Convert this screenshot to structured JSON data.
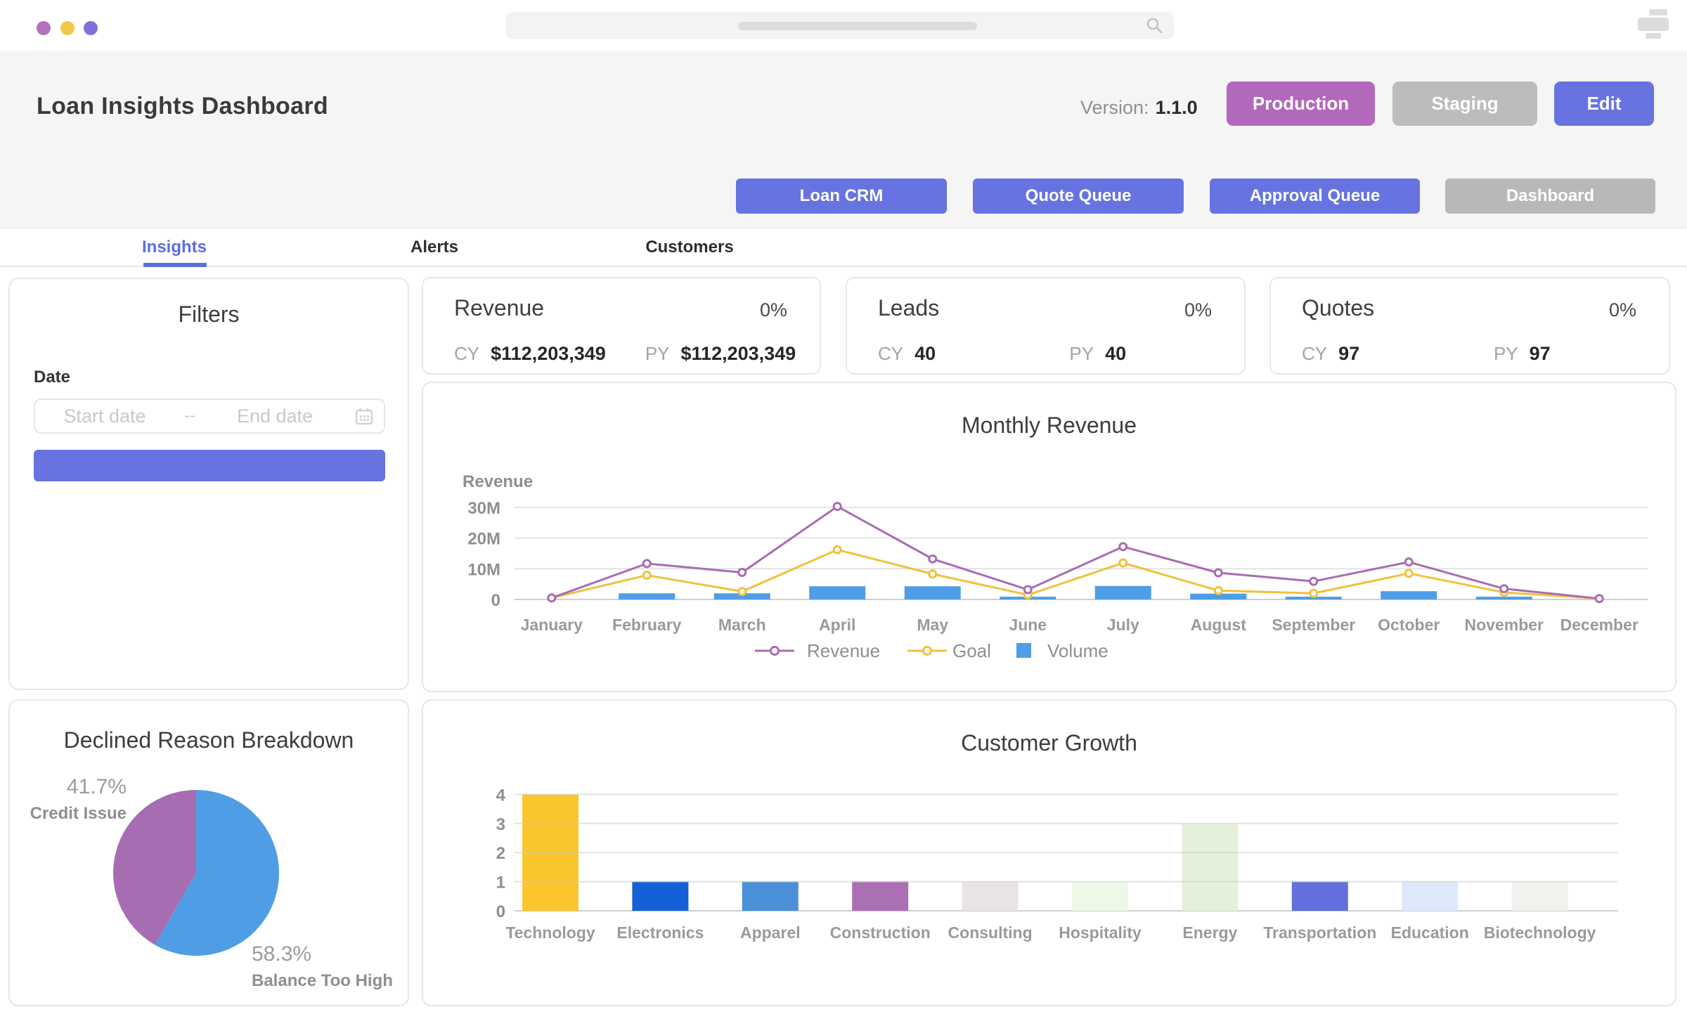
{
  "colors": {
    "accent_indigo": "#6673e0",
    "tab_active": "#5b6ee1",
    "band_background": "#f5f5f5"
  },
  "topbar": {
    "dot_colors": [
      "#b271bb",
      "#f0c94a",
      "#7e72d8"
    ],
    "icons": [
      "search-icon",
      "stacked-bars-menu-icon"
    ]
  },
  "header": {
    "title": "Loan Insights Dashboard",
    "version_label": "Version:",
    "version_value": "1.1.0",
    "env_buttons": [
      {
        "label": "Production",
        "color": "#b269bc"
      },
      {
        "label": "Staging",
        "color": "#bcbcbc"
      },
      {
        "label": "Edit",
        "color": "#6673e0"
      }
    ],
    "nav_buttons": [
      {
        "label": "Loan CRM",
        "color": "#6673e0"
      },
      {
        "label": "Quote Queue",
        "color": "#6673e0"
      },
      {
        "label": "Approval Queue",
        "color": "#6673e0"
      },
      {
        "label": "Dashboard",
        "color": "#b8b8b8"
      }
    ]
  },
  "tabs": [
    {
      "label": "Insights",
      "active": true
    },
    {
      "label": "Alerts",
      "active": false
    },
    {
      "label": "Customers",
      "active": false
    }
  ],
  "filters": {
    "title": "Filters",
    "date_label": "Date",
    "start_placeholder": "Start date",
    "separator": "--",
    "end_placeholder": "End date",
    "icon": "calendar-icon"
  },
  "kpis": [
    {
      "title": "Revenue",
      "delta": "0%",
      "cy_label": "CY",
      "cy_value": "$112,203,349",
      "py_label": "PY",
      "py_value": "$112,203,349"
    },
    {
      "title": "Leads",
      "delta": "0%",
      "cy_label": "CY",
      "cy_value": "40",
      "py_label": "PY",
      "py_value": "40"
    },
    {
      "title": "Quotes",
      "delta": "0%",
      "cy_label": "CY",
      "cy_value": "97",
      "py_label": "PY",
      "py_value": "97"
    }
  ],
  "chart_data": [
    {
      "id": "monthly-revenue",
      "type": "line+bar",
      "title": "Monthly Revenue",
      "ylabel": "Revenue",
      "categories": [
        "January",
        "February",
        "March",
        "April",
        "May",
        "June",
        "July",
        "August",
        "September",
        "October",
        "November",
        "December"
      ],
      "yticks": [
        {
          "v": 0,
          "label": "0"
        },
        {
          "v": 10,
          "label": "10M"
        },
        {
          "v": 20,
          "label": "20M"
        },
        {
          "v": 30,
          "label": "30M"
        }
      ],
      "ylim_millions": [
        0,
        35
      ],
      "legend_position": "bottom",
      "grid": true,
      "series": [
        {
          "name": "Revenue",
          "type": "line",
          "color": "#a76db2",
          "values_millions": [
            0.5,
            11.7,
            8.8,
            30.3,
            13.2,
            3.2,
            17.2,
            8.7,
            5.9,
            12.2,
            3.5,
            0.3
          ]
        },
        {
          "name": "Goal",
          "type": "line",
          "color": "#f0c23c",
          "values_millions": [
            0.5,
            7.9,
            2.6,
            16.2,
            8.3,
            1.5,
            11.9,
            2.9,
            2.0,
            8.5,
            2.3,
            0.3
          ]
        },
        {
          "name": "Volume",
          "type": "bar",
          "color": "#4f9ee5",
          "values_millions": [
            0,
            2.0,
            2.0,
            4.3,
            4.3,
            0.9,
            4.4,
            1.9,
            0.9,
            2.7,
            0.9,
            0
          ]
        }
      ]
    },
    {
      "id": "declined-breakdown",
      "type": "pie",
      "title": "Declined Reason Breakdown",
      "start_angle": "top",
      "direction": "clockwise",
      "slices": [
        {
          "label": "Balance Too High",
          "pct": 58.3,
          "pct_label": "58.3%",
          "color": "#4f9ee5"
        },
        {
          "label": "Credit Issue",
          "pct": 41.7,
          "pct_label": "41.7%",
          "color": "#a76db2"
        }
      ]
    },
    {
      "id": "customer-growth",
      "type": "bar",
      "title": "Customer Growth",
      "categories": [
        "Technology",
        "Electronics",
        "Apparel",
        "Construction",
        "Consulting",
        "Hospitality",
        "Energy",
        "Transportation",
        "Education",
        "Biotechnology"
      ],
      "values": [
        4,
        1,
        1,
        1,
        1,
        1,
        3,
        1,
        1,
        1
      ],
      "bar_colors": [
        "#fbc52d",
        "#1560d6",
        "#4a90d9",
        "#aa6fb5",
        "#e9e4e3",
        "#edf8e7",
        "#e3f1da",
        "#6370dd",
        "#dde9fb",
        "#f0f2ee"
      ],
      "yticks": [
        0,
        1,
        2,
        3,
        4
      ],
      "ylim": [
        0,
        4
      ],
      "grid": true
    }
  ]
}
